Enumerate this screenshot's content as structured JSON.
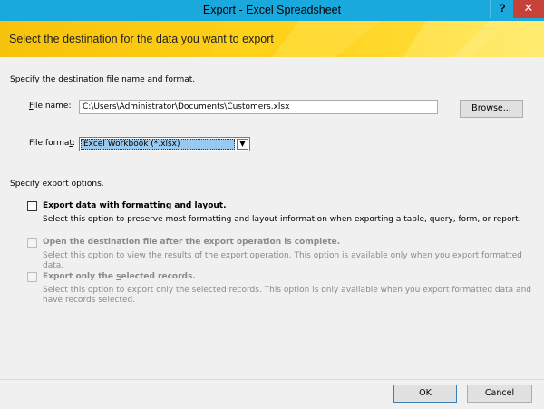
{
  "window": {
    "title": "Export - Excel Spreadsheet",
    "help_label": "?",
    "close_label": "✕"
  },
  "banner": {
    "text": "Select the destination for the data you want to export"
  },
  "destination": {
    "heading": "Specify the destination file name and format.",
    "file_name_label_prefix": "",
    "file_name_label_mnemonic": "F",
    "file_name_label_rest": "ile name:",
    "file_name_value": "C:\\Users\\Administrator\\Documents\\Customers.xlsx",
    "browse_label": "Browse...",
    "file_format_label_prefix": "File forma",
    "file_format_label_mnemonic": "t",
    "file_format_label_rest": ":",
    "file_format_value": "Excel Workbook (*.xlsx)",
    "dropdown_arrow": "▼"
  },
  "options": {
    "heading": "Specify export options.",
    "items": [
      {
        "title_prefix": "Export data ",
        "title_mnemonic": "w",
        "title_rest": "ith formatting and layout.",
        "description": "Select this option to preserve most formatting and layout information when exporting a table, query, form, or report.",
        "checked": false,
        "enabled": true
      },
      {
        "title_prefix": "Open the destination file after the export operation is complete.",
        "title_mnemonic": "",
        "title_rest": "",
        "description": "Select this option to view the results of the export operation. This option is available only when you export formatted data.",
        "checked": false,
        "enabled": false
      },
      {
        "title_prefix": "Export only the ",
        "title_mnemonic": "s",
        "title_rest": "elected records.",
        "description": "Select this option to export only the selected records. This option is only available when you export formatted data and have records selected.",
        "checked": false,
        "enabled": false
      }
    ]
  },
  "footer": {
    "ok_label": "OK",
    "cancel_label": "Cancel"
  }
}
